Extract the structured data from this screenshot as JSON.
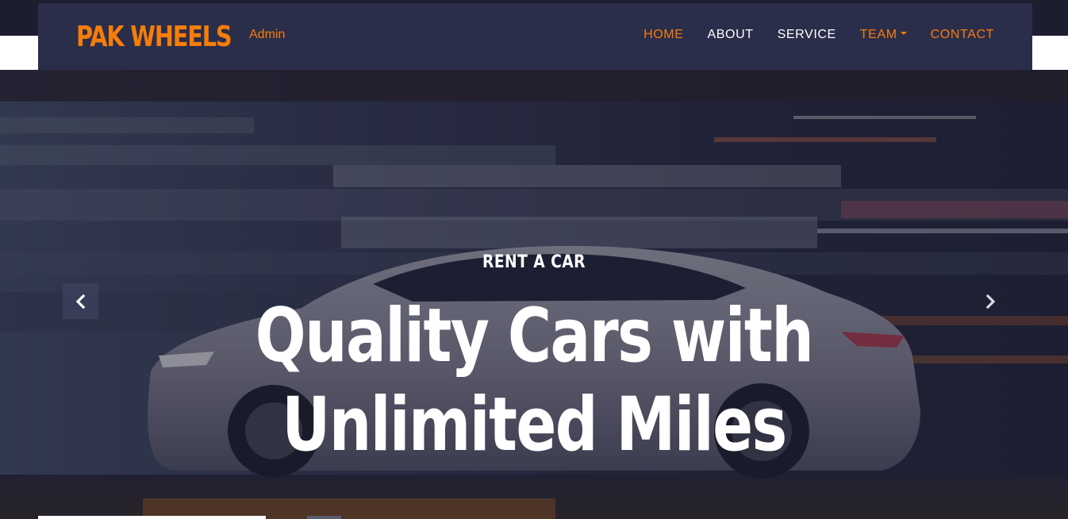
{
  "header": {
    "brand": "PAK WHEELS",
    "brand_sub": "Admin",
    "nav": [
      {
        "label": "HOME",
        "active": true
      },
      {
        "label": "ABOUT"
      },
      {
        "label": "SERVICE"
      },
      {
        "label": "TEAM",
        "dropdown": true
      },
      {
        "label": "CONTACT"
      }
    ]
  },
  "hero": {
    "kicker": "RENT A CAR",
    "title_line1": "Quality Cars with",
    "title_line2": "Unlimited Miles"
  },
  "colors": {
    "accent": "#f77d0a",
    "navbar": "#2b2e4a",
    "top_strip": "#1c1e30",
    "text_light": "#ffffff"
  },
  "icons": {
    "prev": "chevron-left-icon",
    "next": "chevron-right-icon",
    "team_dropdown": "caret-down-icon"
  }
}
